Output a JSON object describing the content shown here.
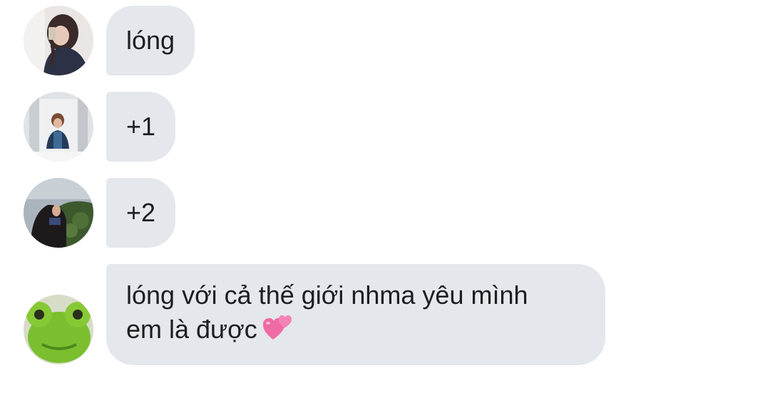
{
  "messages": [
    {
      "text": "lóng",
      "avatar_icon": "profile-photo-girl-dark-hair-icon"
    },
    {
      "text": "+1",
      "avatar_icon": "profile-photo-mirror-selfie-icon"
    },
    {
      "text": "+2",
      "avatar_icon": "profile-photo-girl-outdoor-icon"
    },
    {
      "line1": "lóng với cả thế giới nhma yêu mình",
      "line2": "em là được",
      "emoji": "two-hearts-icon",
      "avatar_icon": "profile-photo-green-plush-frog-icon"
    }
  ],
  "colors": {
    "bubble_bg": "#e4e7ec",
    "text": "#1c1e21",
    "heart": "#f06aa6"
  }
}
